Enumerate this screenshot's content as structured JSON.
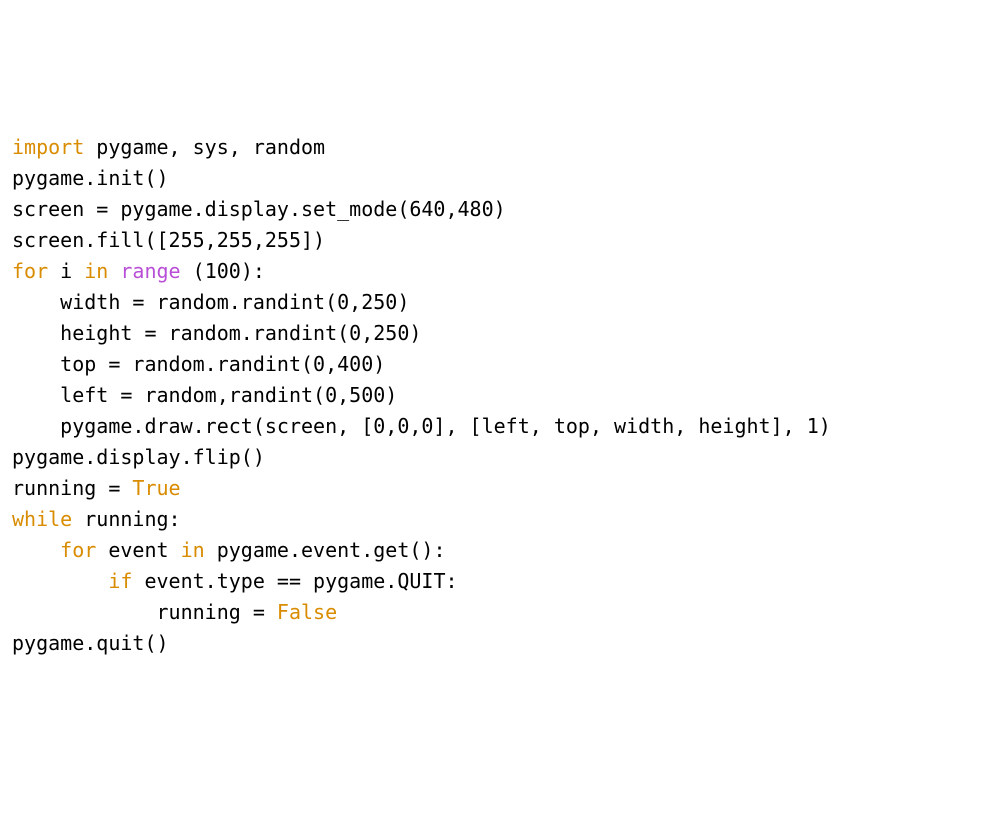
{
  "code": {
    "lines": [
      [
        {
          "text": "import",
          "cls": "c-orange"
        },
        {
          "text": " pygame, sys, random",
          "cls": "c-black"
        }
      ],
      [
        {
          "text": "pygame.init()",
          "cls": "c-black"
        }
      ],
      [
        {
          "text": "screen = pygame.display.set_mode(640,480)",
          "cls": "c-black"
        }
      ],
      [
        {
          "text": "screen.fill([255,255,255])",
          "cls": "c-black"
        }
      ],
      [
        {
          "text": "for",
          "cls": "c-orange"
        },
        {
          "text": " i ",
          "cls": "c-black"
        },
        {
          "text": "in",
          "cls": "c-orange"
        },
        {
          "text": " ",
          "cls": "c-black"
        },
        {
          "text": "range",
          "cls": "c-purple"
        },
        {
          "text": " (100):",
          "cls": "c-black"
        }
      ],
      [
        {
          "text": "    width = random.randint(0,250)",
          "cls": "c-black"
        }
      ],
      [
        {
          "text": "    height = random.randint(0,250)",
          "cls": "c-black"
        }
      ],
      [
        {
          "text": "    top = random.randint(0,400)",
          "cls": "c-black"
        }
      ],
      [
        {
          "text": "    left = random,randint(0,500)",
          "cls": "c-black"
        }
      ],
      [
        {
          "text": "    pygame.draw.rect(screen, [0,0,0], [left, top, width, height], 1)",
          "cls": "c-black"
        }
      ],
      [
        {
          "text": "pygame.display.flip()",
          "cls": "c-black"
        }
      ],
      [
        {
          "text": "running = ",
          "cls": "c-black"
        },
        {
          "text": "True",
          "cls": "c-orange"
        }
      ],
      [
        {
          "text": "while",
          "cls": "c-orange"
        },
        {
          "text": " running:",
          "cls": "c-black"
        }
      ],
      [
        {
          "text": "    ",
          "cls": "c-black"
        },
        {
          "text": "for",
          "cls": "c-orange"
        },
        {
          "text": " event ",
          "cls": "c-black"
        },
        {
          "text": "in",
          "cls": "c-orange"
        },
        {
          "text": " pygame.event.get():",
          "cls": "c-black"
        }
      ],
      [
        {
          "text": "        ",
          "cls": "c-black"
        },
        {
          "text": "if",
          "cls": "c-orange"
        },
        {
          "text": " event.type == pygame.QUIT:",
          "cls": "c-black"
        }
      ],
      [
        {
          "text": "            running = ",
          "cls": "c-black"
        },
        {
          "text": "False",
          "cls": "c-orange"
        }
      ],
      [
        {
          "text": "pygame.quit()",
          "cls": "c-black"
        }
      ]
    ]
  }
}
